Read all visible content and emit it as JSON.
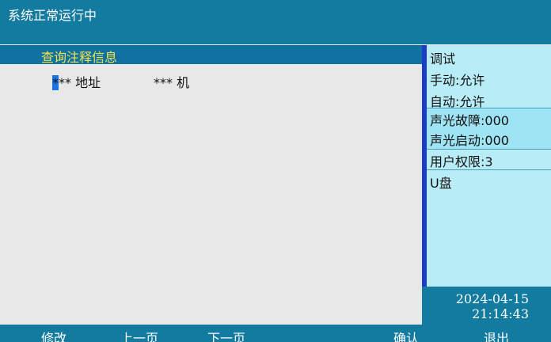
{
  "header": {
    "status_text": "系统正常运行中"
  },
  "panel": {
    "title": "查询注释信息",
    "row": {
      "cursor_char": "*",
      "address_text": "** 地址",
      "machine_text": "*** 机"
    }
  },
  "sidebar": {
    "mode": "调试",
    "manual": "手动:允许",
    "auto": "自动:允许",
    "alarm_fault": "声光故障:000",
    "alarm_start": "声光启动:000",
    "user_level": "用户权限:3",
    "usb": "U盘",
    "date": "2024-04-15",
    "time": "21:14:43"
  },
  "footer": {
    "modify": "修改",
    "prev_page": "上一页",
    "next_page": "下一页",
    "confirm": "确认",
    "exit": "退出"
  },
  "colors": {
    "bar_blue": "#137aa0",
    "title_yellow": "#f5e24a",
    "sidebar_bg": "#b8ecf7",
    "accent_blue": "#1a3cc8",
    "content_bg": "#e8e8e8"
  }
}
